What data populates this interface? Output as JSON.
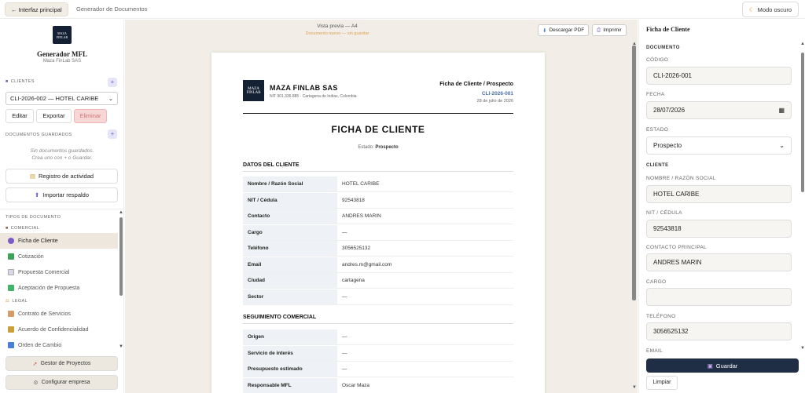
{
  "topbar": {
    "back_label": "← Interfaz principal",
    "title": "Generador de Documentos",
    "dark_mode_label": "Modo oscuro"
  },
  "sidebar": {
    "logo_text": "MAZA FINLAB",
    "app_name": "Generador MFL",
    "app_sub": "Maza FinLab SAS",
    "clients_label": "CLIENTES",
    "client_selected": "CLI-2026-002 — HOTEL CARIBE",
    "edit_label": "Editar",
    "export_label": "Exportar",
    "delete_label": "Eliminar",
    "saved_docs_label": "DOCUMENTOS GUARDADOS",
    "empty_line1": "Sin documentos guardados.",
    "empty_line2": "Crea uno con + o Guardar.",
    "activity_label": "Registro de actividad",
    "import_label": "Importar respaldo",
    "doc_types_label": "TIPOS DE DOCUMENTO",
    "comercial_label": "COMERCIAL",
    "items": [
      {
        "label": "Ficha de Cliente",
        "color": "#7b5cc4"
      },
      {
        "label": "Cotización",
        "color": "#3aa655"
      },
      {
        "label": "Propuesta Comercial",
        "color": "#d8d8e8"
      },
      {
        "label": "Aceptación de Propuesta",
        "color": "#43b36a"
      }
    ],
    "legal_label": "LEGAL",
    "legal_items": [
      {
        "label": "Contrato de Servicios",
        "color": "#d89a6a"
      },
      {
        "label": "Acuerdo de Confidencialidad",
        "color": "#c9a03a"
      },
      {
        "label": "Orden de Cambio",
        "color": "#4a7fd4"
      }
    ],
    "projects_label": "Gestor de Proyectos",
    "company_label": "Configurar empresa"
  },
  "center": {
    "preview_label": "Vista previa — A4",
    "preview_sub": "Documento nuevo — sin guardar",
    "pdf_label": "Descargar PDF",
    "print_label": "Imprimir"
  },
  "doc": {
    "logo_text": "MAZA FINLAB",
    "company": "MAZA FINLAB SAS",
    "company_sub": "NIT 901.336.885 · Cartagena de Indias, Colombia",
    "doc_type": "Ficha de Cliente / Prospecto",
    "code": "CLI-2026-001",
    "date": "28 de julio de 2026",
    "title": "FICHA DE CLIENTE",
    "status_prefix": "Estado:",
    "status_value": "Prospecto",
    "section1": "DATOS DEL CLIENTE",
    "rows1": [
      {
        "k": "Nombre / Razón Social",
        "v": "HOTEL CARIBE"
      },
      {
        "k": "NIT / Cédula",
        "v": "92543818"
      },
      {
        "k": "Contacto",
        "v": "ANDRES MARIN"
      },
      {
        "k": "Cargo",
        "v": "—"
      },
      {
        "k": "Teléfono",
        "v": "3056525132"
      },
      {
        "k": "Email",
        "v": "andres.m@gmail.com"
      },
      {
        "k": "Ciudad",
        "v": "cartagena"
      },
      {
        "k": "Sector",
        "v": "—"
      }
    ],
    "section2": "SEGUIMIENTO COMERCIAL",
    "rows2": [
      {
        "k": "Origen",
        "v": "—"
      },
      {
        "k": "Servicio de interés",
        "v": "—"
      },
      {
        "k": "Presupuesto estimado",
        "v": "—"
      },
      {
        "k": "Responsable MFL",
        "v": "Oscar Maza"
      }
    ]
  },
  "form": {
    "title": "Ficha de Cliente",
    "doc_section": "DOCUMENTO",
    "code_label": "CÓDIGO",
    "code_value": "CLI-2026-001",
    "date_label": "FECHA",
    "date_value": "28/07/2026",
    "state_label": "ESTADO",
    "state_value": "Prospecto",
    "client_section": "CLIENTE",
    "name_label": "NOMBRE / RAZÓN SOCIAL",
    "name_value": "HOTEL CARIBE",
    "nit_label": "NIT / CÉDULA",
    "nit_value": "92543818",
    "contact_label": "CONTACTO PRINCIPAL",
    "contact_value": "ANDRES MARIN",
    "role_label": "CARGO",
    "role_value": "",
    "phone_label": "TELÉFONO",
    "phone_value": "3056525132",
    "email_label": "EMAIL",
    "save_label": "Guardar",
    "clear_label": "Limpiar"
  }
}
